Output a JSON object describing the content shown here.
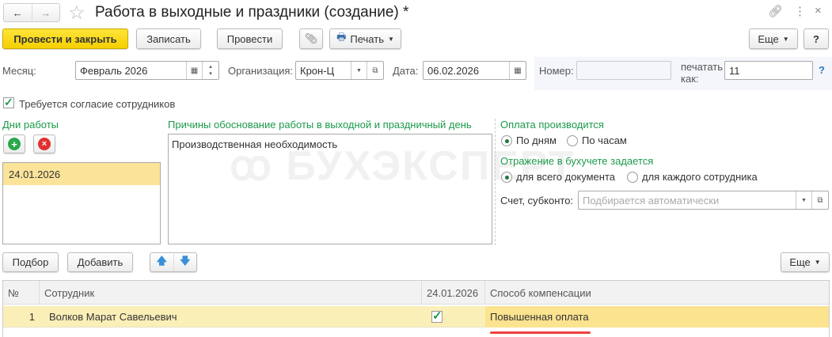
{
  "window": {
    "title": "Работа в выходные и праздники (создание) *",
    "nav_back": "←",
    "nav_forward": "→"
  },
  "toolbar": {
    "post_close": "Провести и закрыть",
    "save": "Записать",
    "post": "Провести",
    "print": "Печать",
    "more": "Еще",
    "help": "?"
  },
  "header": {
    "month_label": "Месяц:",
    "month_value": "Февраль 2026",
    "org_label": "Организация:",
    "org_value": "Крон-Ц",
    "date_label": "Дата:",
    "date_value": "06.02.2026",
    "number_label": "Номер:",
    "number_value": "",
    "print_as_label": "печатать как:",
    "print_as_value": "11",
    "print_as_help": "?"
  },
  "consent": {
    "label": "Требуется согласие сотрудников",
    "checked": true
  },
  "work_days": {
    "title": "Дни работы",
    "items": [
      "24.01.2026"
    ]
  },
  "reasons": {
    "title": "Причины обоснование работы в выходной и праздничный день",
    "value": "Производственная необходимость"
  },
  "payment": {
    "title": "Оплата производится",
    "options": [
      "По дням",
      "По часам"
    ],
    "selected": 0
  },
  "accounting": {
    "title": "Отражение в бухучете задается",
    "options": [
      "для всего документа",
      "для каждого сотрудника"
    ],
    "selected": 0,
    "account_label": "Счет, субконто:",
    "account_placeholder": "Подбирается автоматически"
  },
  "table_toolbar": {
    "select": "Подбор",
    "add": "Добавить",
    "more": "Еще"
  },
  "table": {
    "columns": [
      "№",
      "Сотрудник",
      "24.01.2026",
      "Способ компенсации"
    ],
    "rows": [
      {
        "n": "1",
        "employee": "Волков Марат Савельевич",
        "day_checked": true,
        "compensation": "Повышенная оплата"
      }
    ]
  },
  "watermark": "БУХЭКСПЕРТ",
  "colors": {
    "accent_green": "#1c9a4a",
    "yellow_button": "#f5cf00",
    "selected_row": "#fbefb8",
    "highlight_cell": "#fce38f",
    "underline": "#f04040"
  }
}
